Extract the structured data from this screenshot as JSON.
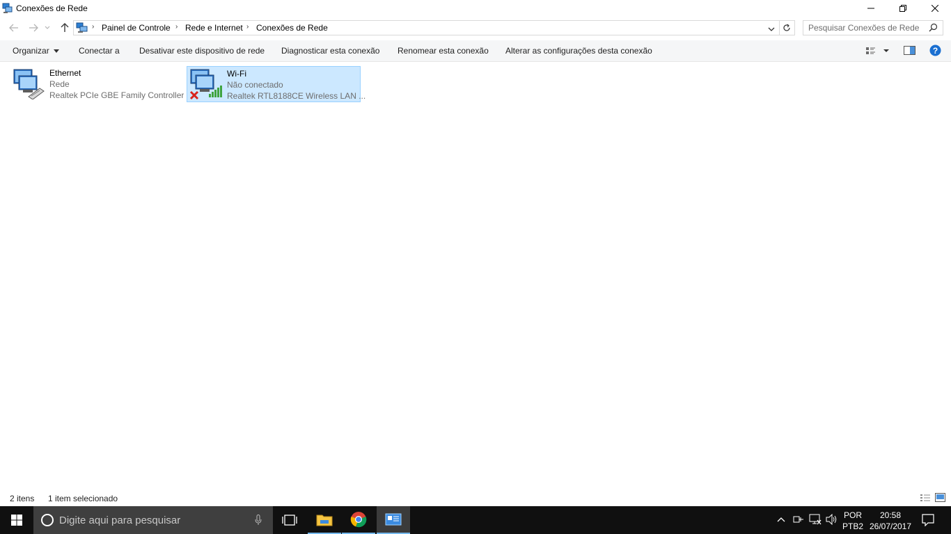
{
  "window": {
    "title": "Conexões de Rede"
  },
  "address": {
    "breadcrumbs": [
      "Painel de Controle",
      "Rede e Internet",
      "Conexões de Rede"
    ],
    "search_placeholder": "Pesquisar Conexões de Rede"
  },
  "commandbar": {
    "organize": "Organizar",
    "connect": "Conectar a",
    "disable": "Desativar este dispositivo de rede",
    "diagnose": "Diagnosticar esta conexão",
    "rename": "Renomear esta conexão",
    "change": "Alterar as configurações desta conexão"
  },
  "items": [
    {
      "name": "Ethernet",
      "status": "Rede",
      "device": "Realtek PCIe GBE Family Controller"
    },
    {
      "name": "Wi-Fi",
      "status": "Não conectado",
      "device": "Realtek RTL8188CE Wireless LAN ..."
    }
  ],
  "statusbar": {
    "count": "2 itens",
    "selected": "1 item selecionado"
  },
  "taskbar": {
    "search_placeholder": "Digite aqui para pesquisar",
    "lang_top": "POR",
    "lang_bottom": "PTB2",
    "time": "20:58",
    "date": "26/07/2017"
  },
  "colors": {
    "selection_bg": "#cce8ff",
    "selection_border": "#99d1ff",
    "taskbar_bg": "#101010",
    "help_blue": "#1a6fd1"
  }
}
